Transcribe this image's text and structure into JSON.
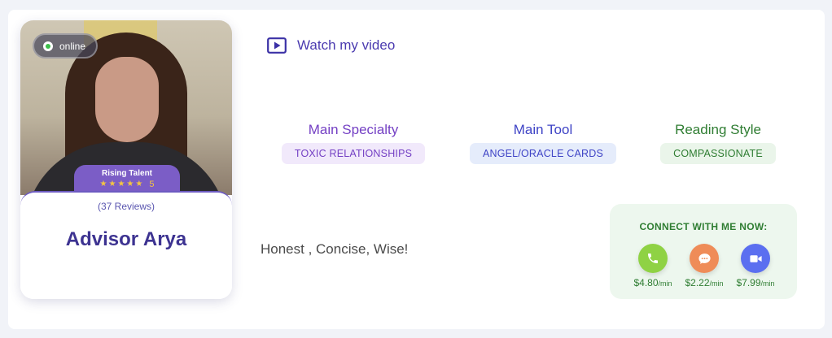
{
  "advisor": {
    "status": "online",
    "badge_title": "Rising Talent",
    "rating": "5",
    "reviews": "(37 Reviews)",
    "name": "Advisor Arya"
  },
  "video": {
    "label": "Watch my video"
  },
  "specialties": [
    {
      "title": "Main Specialty",
      "value": "TOXIC RELATIONSHIPS"
    },
    {
      "title": "Main Tool",
      "value": "ANGEL/ORACLE CARDS"
    },
    {
      "title": "Reading Style",
      "value": "COMPASSIONATE"
    }
  ],
  "tagline": "Honest , Concise, Wise!",
  "connect": {
    "title": "CONNECT WITH ME NOW:",
    "unit": "/min",
    "channels": [
      {
        "icon": "phone-icon",
        "price": "$4.80",
        "color": "#8fd244"
      },
      {
        "icon": "chat-icon",
        "price": "$2.22",
        "color": "#ef8c58"
      },
      {
        "icon": "video-camera-icon",
        "price": "$7.99",
        "color": "#5b6ff0"
      }
    ]
  },
  "colors": {
    "accent_purple": "#4b3bb0",
    "advisor_name": "#3d3391",
    "badge": "#7b5dc6",
    "green": "#2f7d32"
  }
}
